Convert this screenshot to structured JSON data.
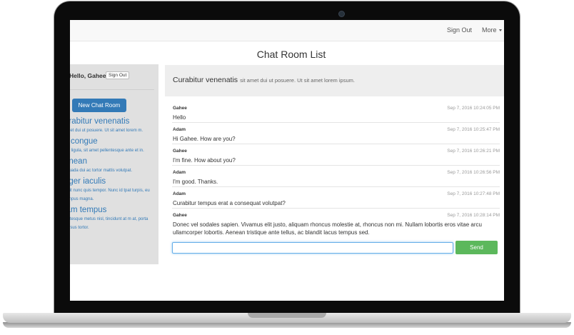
{
  "navbar": {
    "sign_out": "Sign Out",
    "more": "More"
  },
  "page": {
    "title": "Chat Room List"
  },
  "sidebar": {
    "greeting": "Hello, Gahee",
    "sign_out_button": "Sign Out",
    "new_room_button": "New Chat Room",
    "rooms": [
      {
        "name": "urabitur venenatis",
        "desc": "amet dui ut posuere. Ut sit amet lorem m."
      },
      {
        "name": "s congue",
        "desc": "tas ligula, sit amet pellentesque ante et in."
      },
      {
        "name": "enean",
        "desc": "esuada dui ac tortor mattis volutpat."
      },
      {
        "name": "eger iaculis",
        "desc": "cipit nunc quis tempor. Nunc id tpat turpis, eu tempus magna."
      },
      {
        "name": "iam tempus",
        "desc": "lentesque metus nisl, tincidunt at m at, porta cursus tortor."
      }
    ]
  },
  "room": {
    "title": "Curabitur venenatis",
    "subtitle": "sit amet dui ut posuere. Ut sit amet lorem ipsum."
  },
  "messages": [
    {
      "author": "Gahee",
      "time": "Sep 7, 2016 10:24:05 PM",
      "text": "Hello"
    },
    {
      "author": "Adam",
      "time": "Sep 7, 2016 10:25:47 PM",
      "text": "Hi Gahee. How are you?"
    },
    {
      "author": "Gahee",
      "time": "Sep 7, 2016 10:26:21 PM",
      "text": "I'm fine. How about you?"
    },
    {
      "author": "Adam",
      "time": "Sep 7, 2016 10:26:56 PM",
      "text": "I'm good. Thanks."
    },
    {
      "author": "Adam",
      "time": "Sep 7, 2016 10:27:48 PM",
      "text": "Curabitur tempus erat a consequat volutpat?"
    },
    {
      "author": "Gahee",
      "time": "Sep 7, 2016 10:28:14 PM",
      "text": "Donec vel sodales sapien. Vivamus elit justo, aliquam rhoncus molestie at, rhoncus non mi. Nullam lobortis eros vitae arcu ullamcorper lobortis. Aenean tristique ante tellus, ac blandit lacus tempus sed."
    }
  ],
  "composer": {
    "value": "",
    "send_button": "Send"
  },
  "colors": {
    "primary": "#337ab7",
    "success": "#5cb85c",
    "focus": "#66afe9"
  }
}
